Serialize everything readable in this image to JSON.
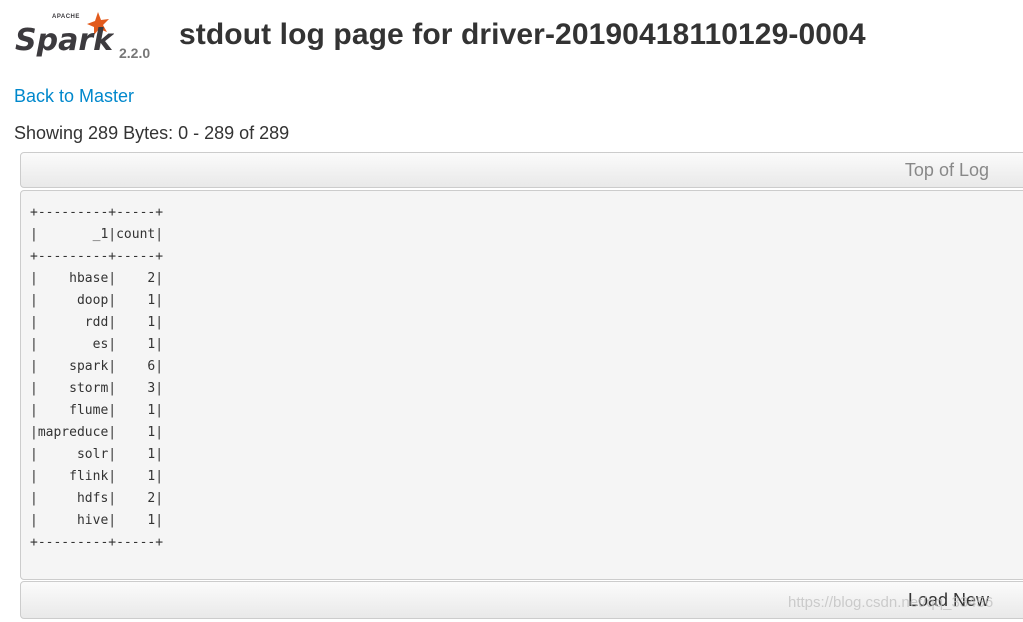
{
  "header": {
    "logo_apache": "APACHE",
    "logo_text": "Spark",
    "version": "2.2.0",
    "title": "stdout log page for driver-20190418110129-0004"
  },
  "nav": {
    "back_link": "Back to Master"
  },
  "summary": {
    "showing": "Showing 289 Bytes: 0 - 289 of 289"
  },
  "log": {
    "top_button": "Top of Log",
    "load_button": "Load New",
    "content": "+---------+-----+\n|       _1|count|\n+---------+-----+\n|    hbase|    2|\n|     doop|    1|\n|      rdd|    1|\n|       es|    1|\n|    spark|    6|\n|    storm|    3|\n|    flume|    1|\n|mapreduce|    1|\n|     solr|    1|\n|    flink|    1|\n|     hdfs|    2|\n|     hive|    1|\n+---------+-----+"
  },
  "watermark": "https://blog.csdn.net/qq_33456",
  "colors": {
    "link": "#0088cc",
    "logo_orange": "#e25a1c",
    "logo_gray": "#3c3a3e",
    "log_background": "#f5f5f5"
  },
  "icons": {
    "logo": "spark-star-logo"
  }
}
